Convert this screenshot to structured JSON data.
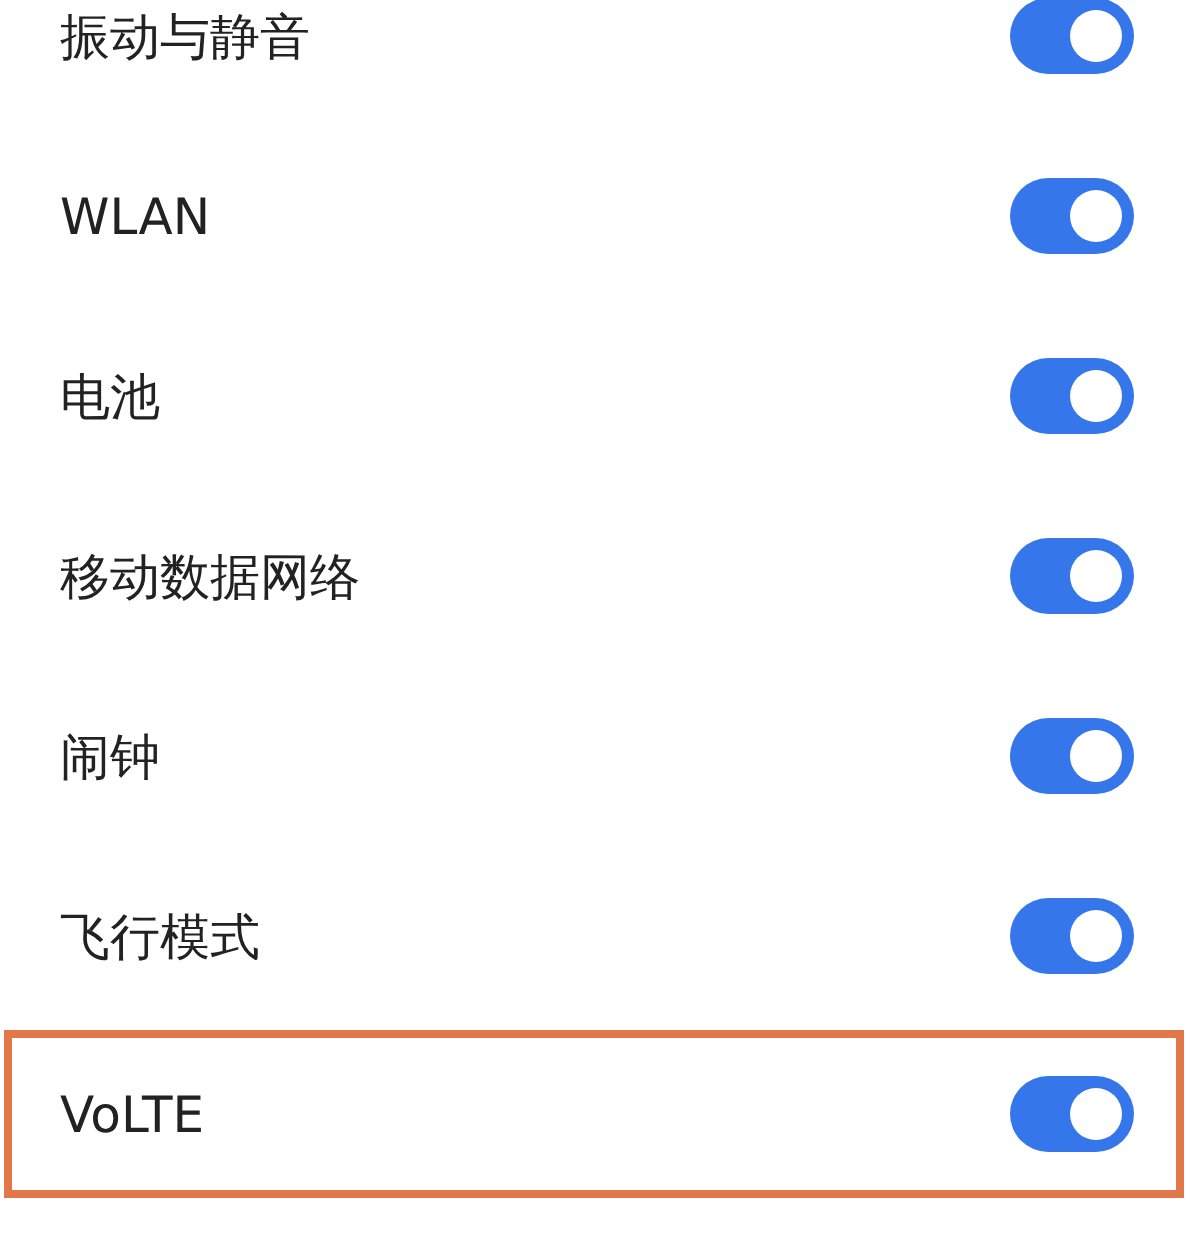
{
  "settings": [
    {
      "label": "振动与静音",
      "on": true,
      "highlighted": false
    },
    {
      "label": "WLAN",
      "on": true,
      "highlighted": false
    },
    {
      "label": "电池",
      "on": true,
      "highlighted": false
    },
    {
      "label": "移动数据网络",
      "on": true,
      "highlighted": false
    },
    {
      "label": "闹钟",
      "on": true,
      "highlighted": false
    },
    {
      "label": "飞行模式",
      "on": true,
      "highlighted": false
    },
    {
      "label": "VoLTE",
      "on": true,
      "highlighted": true
    }
  ]
}
